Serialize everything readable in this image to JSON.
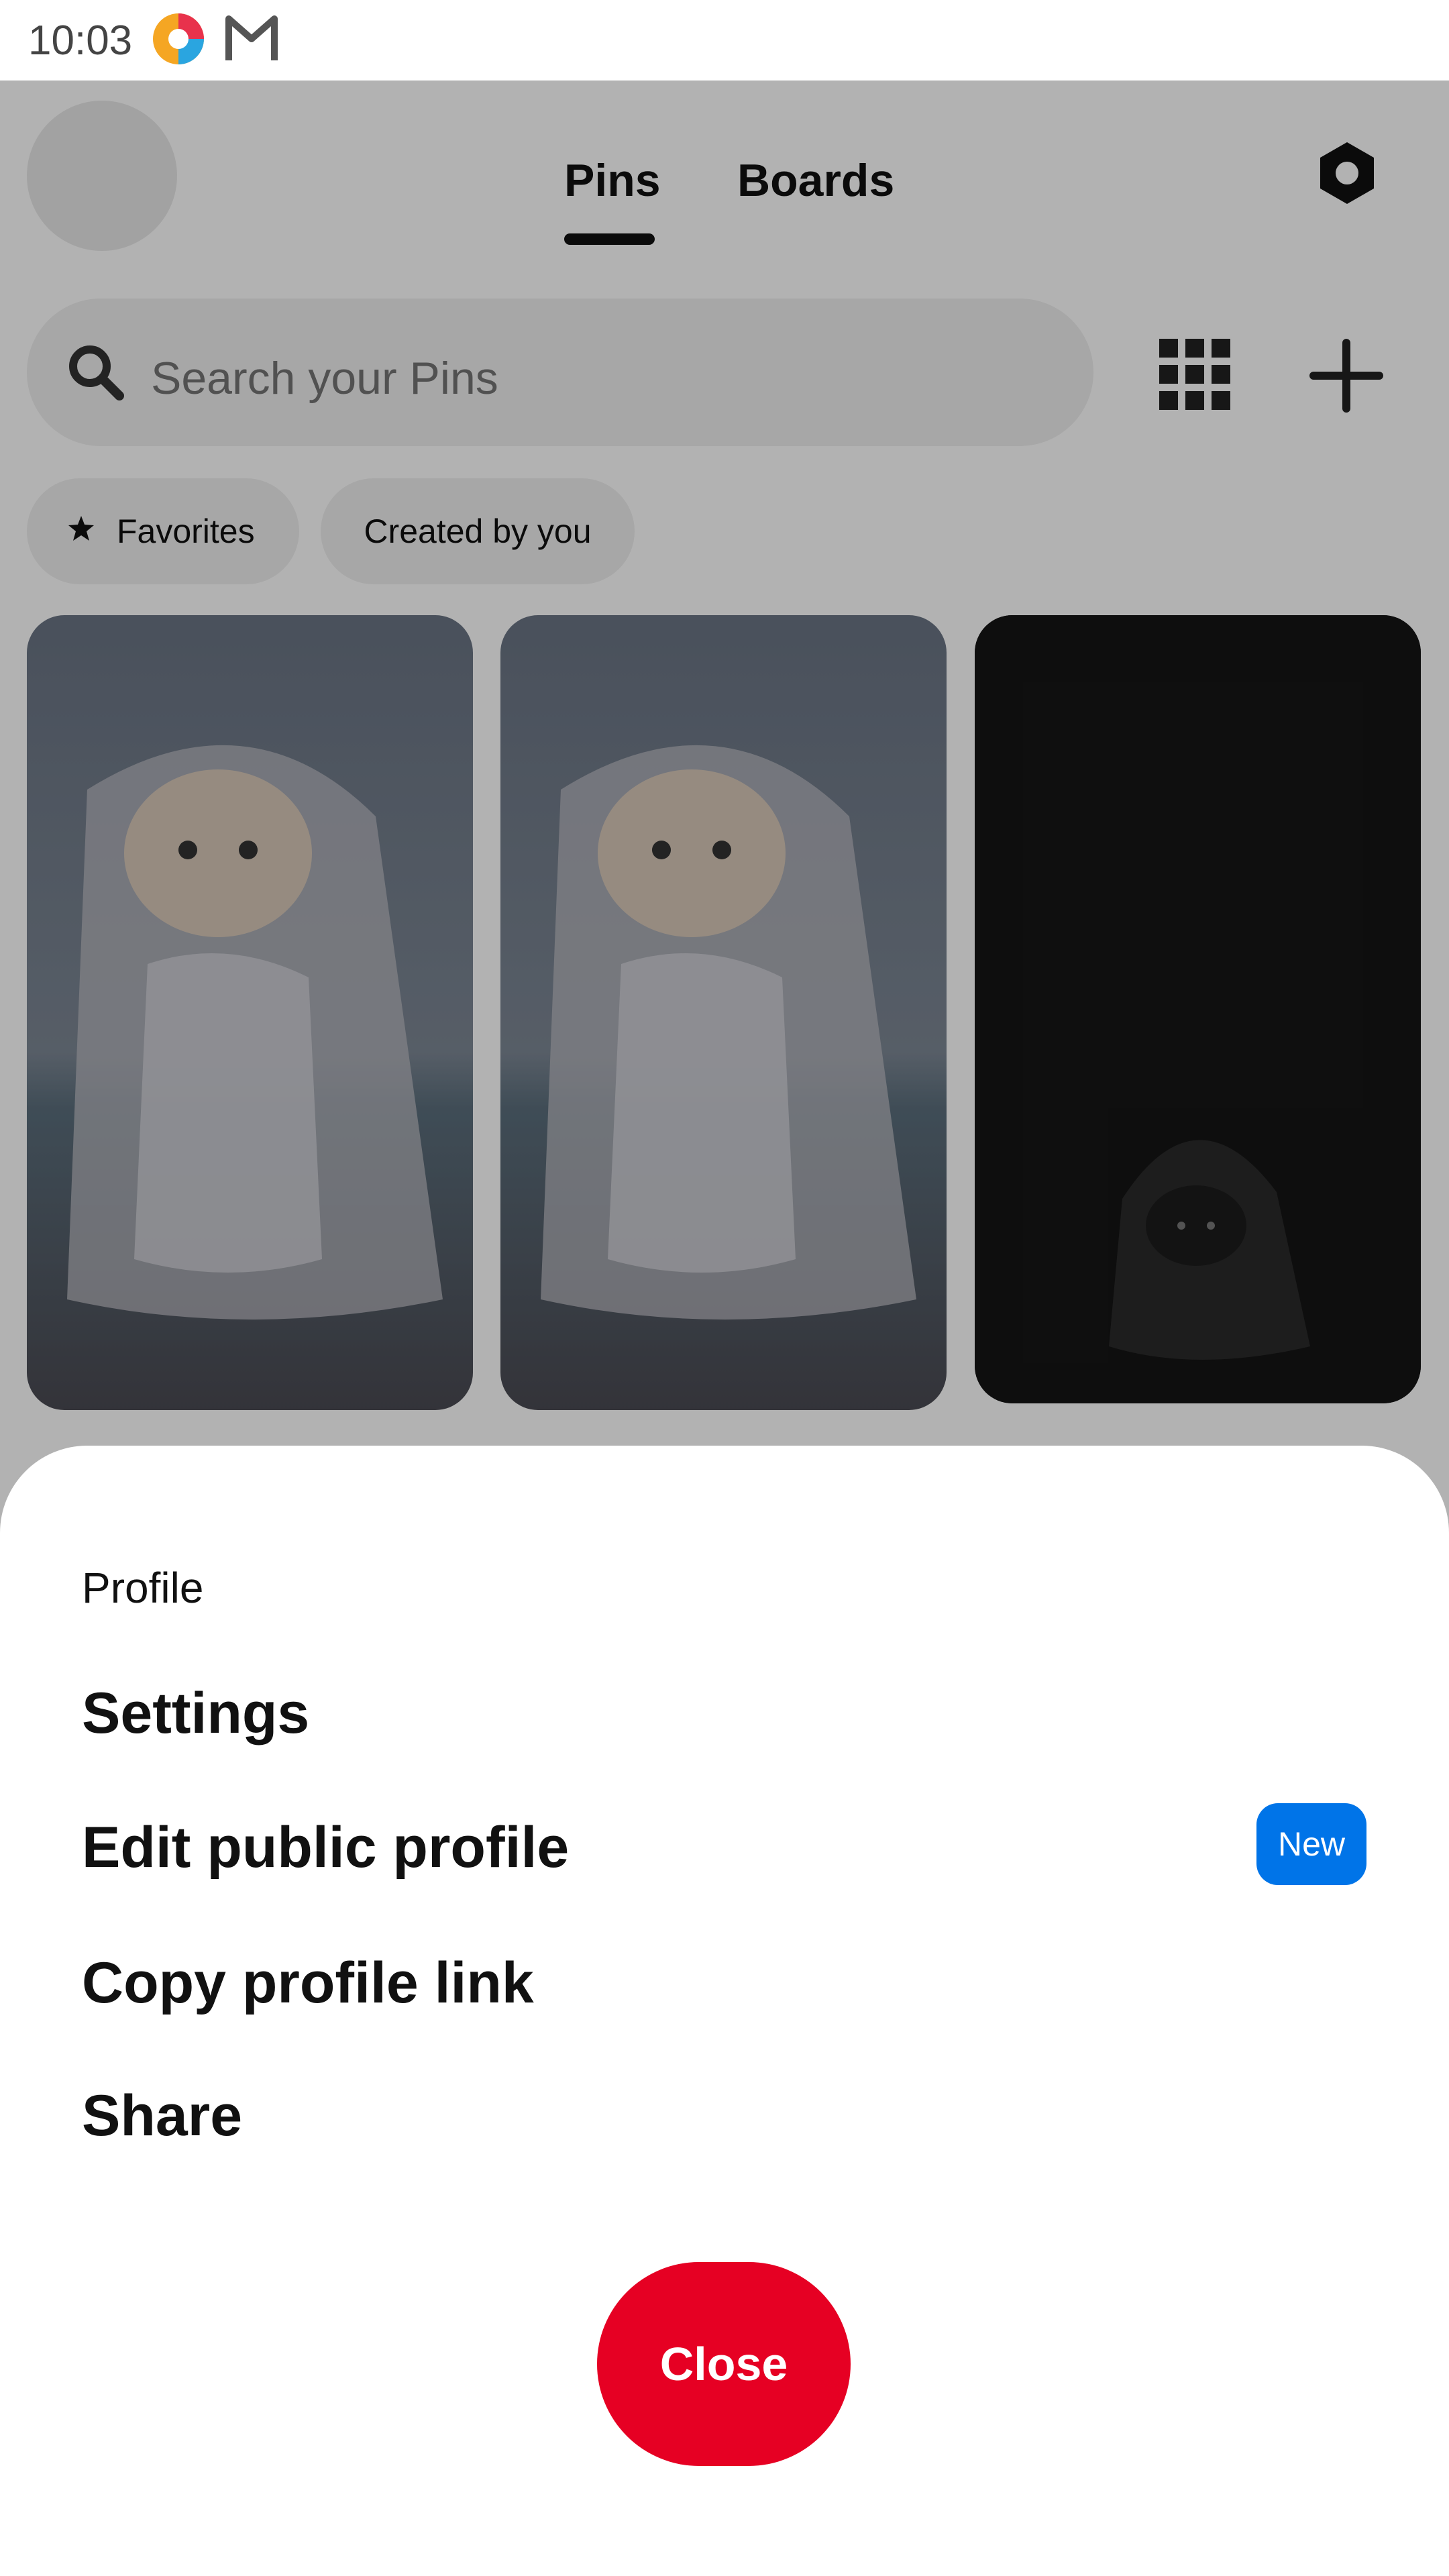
{
  "status_bar": {
    "time": "10:03"
  },
  "header": {
    "tabs": [
      {
        "label": "Pins",
        "active": true
      },
      {
        "label": "Boards",
        "active": false
      }
    ]
  },
  "search": {
    "placeholder": "Search your Pins"
  },
  "filters": {
    "favorites_label": "Favorites",
    "created_label": "Created by you"
  },
  "pins": [
    {
      "icon": "cat-in-raincoat-image"
    },
    {
      "icon": "cat-in-raincoat-image"
    },
    {
      "icon": "hooded-cat-dark-image"
    }
  ],
  "sheet": {
    "title": "Profile",
    "items": [
      {
        "label": "Settings"
      },
      {
        "label": "Edit public profile",
        "badge": "New"
      },
      {
        "label": "Copy profile link"
      },
      {
        "label": "Share"
      }
    ],
    "close_label": "Close"
  },
  "colors": {
    "accent_red": "#e60023",
    "badge_blue": "#0074e8",
    "text": "#111111"
  }
}
